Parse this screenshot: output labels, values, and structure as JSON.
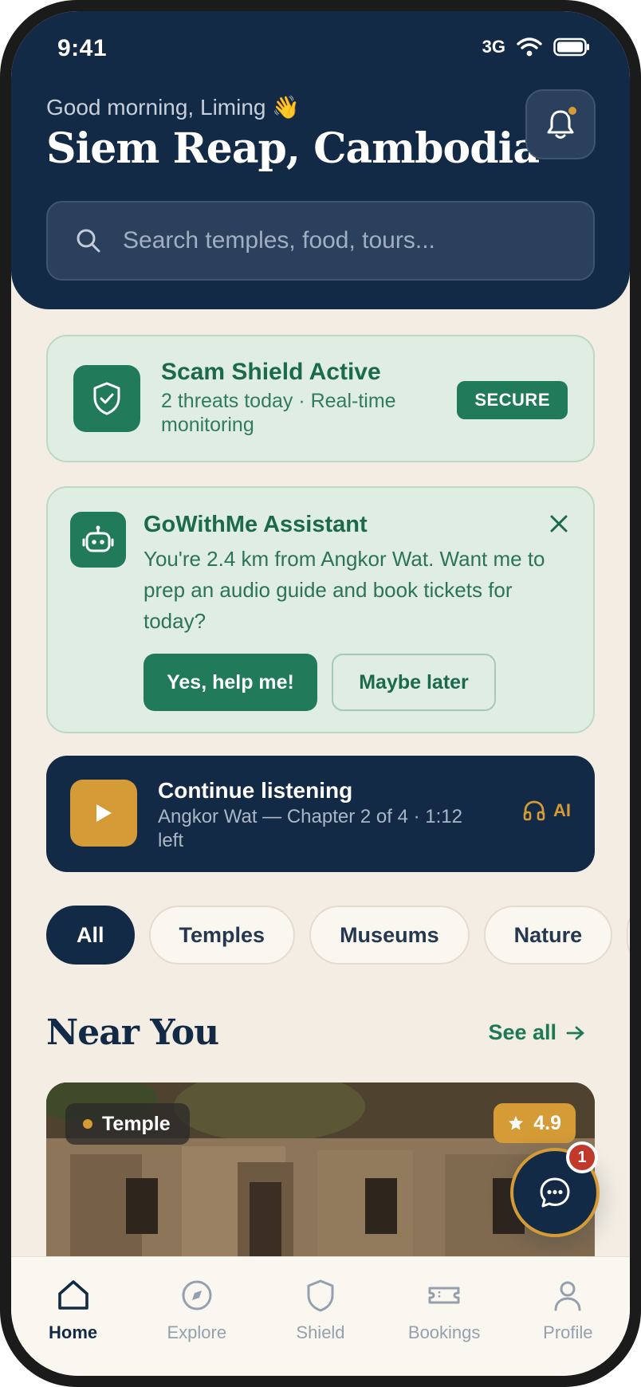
{
  "status_bar": {
    "time": "9:41",
    "network": "3G"
  },
  "header": {
    "greeting": "Good morning, Liming 👋",
    "city": "Siem Reap, Cambodia"
  },
  "search": {
    "placeholder": "Search temples, food, tours..."
  },
  "shield": {
    "title": "Scam Shield Active",
    "subtitle": "2 threats today · Real-time monitoring",
    "badge": "SECURE"
  },
  "assistant": {
    "title": "GoWithMe Assistant",
    "message": "You're 2.4 km from Angkor Wat. Want me to prep an audio guide and book tickets for today?",
    "primary_button": "Yes, help me!",
    "secondary_button": "Maybe later"
  },
  "listening": {
    "title": "Continue listening",
    "subtitle": "Angkor Wat — Chapter 2 of 4 · 1:12 left",
    "tag": "AI"
  },
  "chips": [
    "All",
    "Temples",
    "Museums",
    "Nature"
  ],
  "near_you": {
    "title": "Near You",
    "see_all": "See all",
    "card": {
      "tag": "Temple",
      "rating": "4.9"
    }
  },
  "chat": {
    "badge_count": "1"
  },
  "nav": {
    "items": [
      {
        "label": "Home"
      },
      {
        "label": "Explore"
      },
      {
        "label": "Shield"
      },
      {
        "label": "Bookings"
      },
      {
        "label": "Profile"
      }
    ]
  },
  "colors": {
    "navy": "#132a46",
    "green": "#217a5a",
    "gold": "#d49b36",
    "cream": "#f3ede3"
  }
}
